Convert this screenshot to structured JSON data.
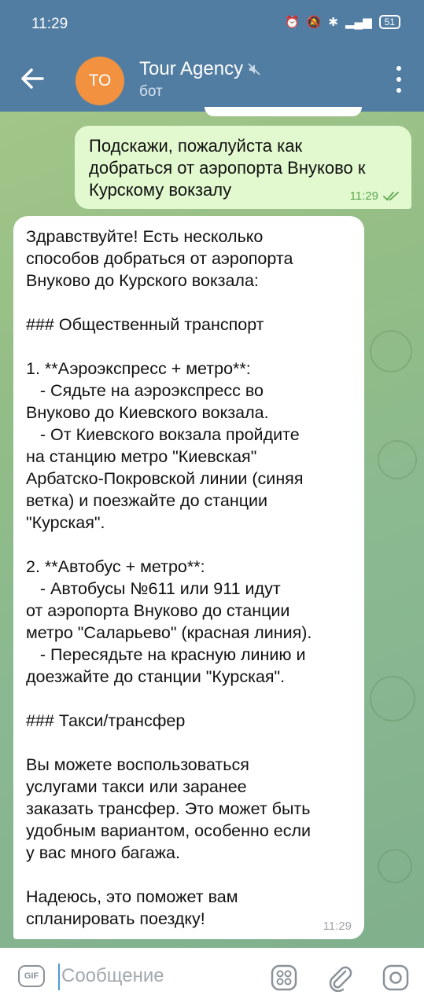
{
  "status_bar": {
    "time": "11:29",
    "battery": "51"
  },
  "header": {
    "avatar_initials": "TO",
    "title": "Tour Agency",
    "subtitle": "бот"
  },
  "messages": [
    {
      "direction": "outgoing",
      "text": "Подскажи, пожалуйста как\nдобраться от аэропорта Внуково к\nКурскому вокзалу",
      "time": "11:29",
      "status": "read"
    },
    {
      "direction": "incoming",
      "text": "Здравствуйте! Есть несколько\nспособов добраться от аэропорта\nВнуково до Курского вокзала:\n\n### Общественный транспорт\n\n1. **Аэроэкспресс + метро**:\n   - Сядьте на аэроэкспресс во\nВнуково до Киевского вокзала.\n   - От Киевского вокзала пройдите\nна станцию метро \"Киевская\"\nАрбатско-Покровской линии (синяя\nветка) и поезжайте до станции\n\"Курская\".\n\n2. **Автобус + метро**:\n   - Автобусы №611 или 911 идут\nот аэропорта Внуково до станции\nметро \"Саларьево\" (красная линия).\n   - Пересядьте на красную линию и\nдоезжайте до станции \"Курская\".\n\n### Такси/трансфер\n\nВы можете воспользоваться\nуслугами такси или заранее\nзаказать трансфер. Это может быть\nудобным вариантом, особенно если\nу вас много багажа.\n\nНадеюсь, это поможет вам\nспланировать поездку!",
      "time": "11:29"
    }
  ],
  "input_bar": {
    "placeholder": "Сообщение",
    "value": "",
    "gif_label": "GIF"
  },
  "colors": {
    "header": "#527da3",
    "outgoing_bubble": "#e2f9cf",
    "incoming_bubble": "#ffffff",
    "avatar": "#f2913f",
    "read_check": "#5ea650"
  },
  "icons": [
    "back-arrow-icon",
    "muted-icon",
    "more-vert-icon",
    "gif-icon",
    "sticker-icon",
    "attach-icon",
    "camera-icon",
    "alarm-icon",
    "mute-bell-icon",
    "bluetooth-icon",
    "signal-icon"
  ]
}
